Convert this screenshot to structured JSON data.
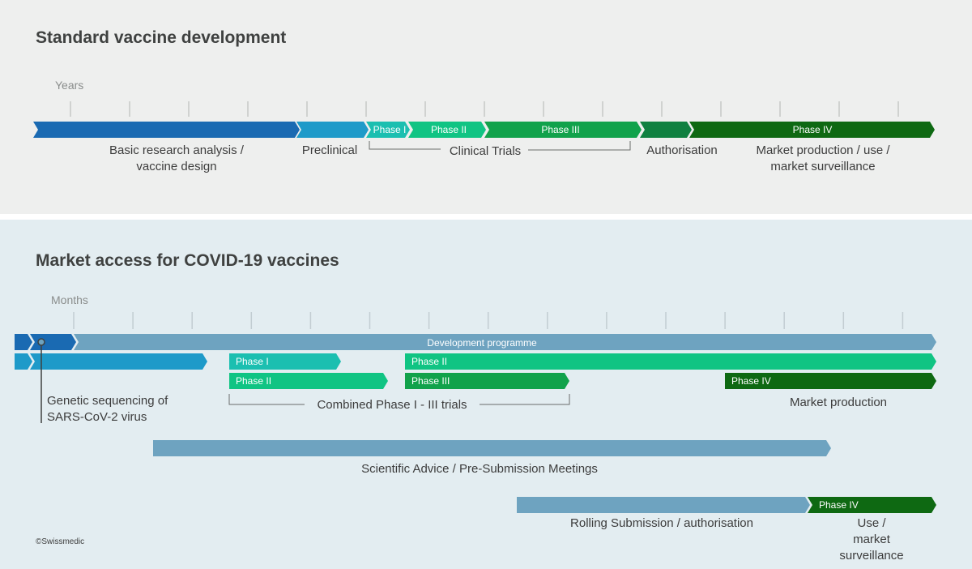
{
  "colors": {
    "blue_dark": "#1a6ab2",
    "blue_mid": "#1e9ac9",
    "teal": "#1bbfb0",
    "green_light": "#10c483",
    "green": "#11a24b",
    "green_dark2": "#0f8040",
    "green_darkest": "#0e6912",
    "steel": "#6ea3c0"
  },
  "standard": {
    "title": "Standard vaccine development",
    "unit": "Years",
    "bar_labels": {
      "phase1": "Phase I",
      "phase2": "Phase II",
      "phase3": "Phase III",
      "phase4": "Phase IV"
    },
    "labels": {
      "basic_research": "Basic research analysis /\nvaccine design",
      "preclinical": "Preclinical",
      "clinical_trials": "Clinical Trials",
      "authorisation": "Authorisation",
      "market": "Market production / use /\nmarket surveillance"
    }
  },
  "covid": {
    "title": "Market access for COVID-19 vaccines",
    "unit": "Months",
    "bar_labels": {
      "development": "Development programme",
      "phase1": "Phase I",
      "phase2_a": "Phase II",
      "phase2_b": "Phase II",
      "phase3": "Phase III",
      "phase4": "Phase IV",
      "phase4_use": "Phase IV"
    },
    "labels": {
      "genetic": "Genetic sequencing of\nSARS-CoV-2 virus",
      "combined": "Combined Phase I - III trials",
      "market_production": "Market production",
      "scientific_advice": "Scientific Advice / Pre-Submission Meetings",
      "rolling": "Rolling Submission / authorisation",
      "use": "Use /\nmarket surveillance"
    }
  },
  "copyright": "©Swissmedic"
}
